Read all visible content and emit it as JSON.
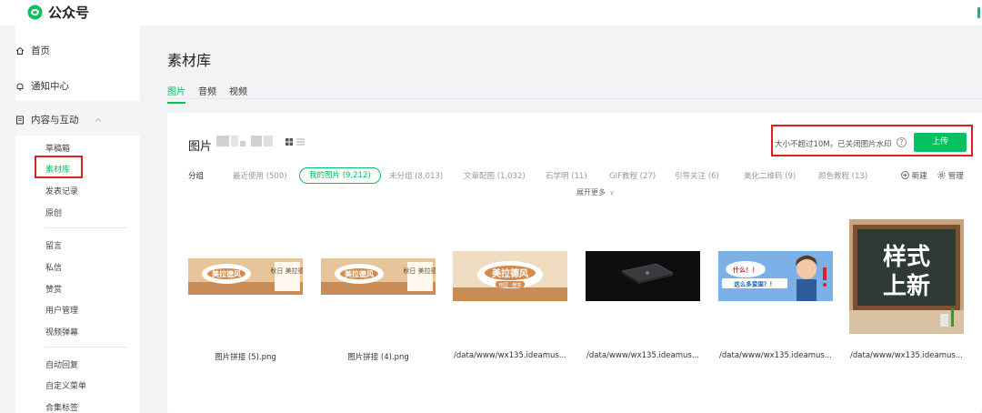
{
  "app": {
    "title": "公众号"
  },
  "sidebar": {
    "home": "首页",
    "notify": "通知中心",
    "content_section": "内容与互动",
    "items_a": [
      "草稿箱",
      "素材库",
      "发表记录",
      "原创"
    ],
    "items_b": [
      "留言",
      "私信",
      "赞赏",
      "用户管理",
      "视频弹幕"
    ],
    "items_c": [
      "自动回复",
      "自定义菜单",
      "合集标签"
    ]
  },
  "main": {
    "title": "素材库",
    "tabs": [
      {
        "label": "图片"
      },
      {
        "label": "音频"
      },
      {
        "label": "视频"
      }
    ]
  },
  "library": {
    "heading": "图片",
    "upload_hint": "大小不超过10M，已关闭图片水印",
    "help_icon": "?",
    "upload_label": "上传",
    "groups_label": "分组",
    "groups": [
      "最近使用 (500)",
      "我的图片 (9,212)",
      "未分组 (8,013)",
      "文章配图 (1,032)",
      "石学明 (11)",
      "GIF教程 (27)",
      "引导关注 (6)",
      "美化二维码 (9)",
      "颜色教程 (13)"
    ],
    "new_label": "新建",
    "manage_label": "管理",
    "expand_label": "展开更多",
    "expand_arrow": "∨",
    "images": [
      {
        "name": "图片拼接 (5).png",
        "caption_a": "美拉德风",
        "caption_b": "秋日 美拉德"
      },
      {
        "name": "图片拼接 (4).png",
        "caption_a": "美拉德风",
        "caption_b": "秋日 美拉德"
      },
      {
        "name": "/data/www/wx135.ideamus...",
        "caption_a": "美拉德风",
        "caption_b": "田园 · 暖意"
      },
      {
        "name": "/data/www/wx135.ideamus...",
        "caption_a": "",
        "caption_b": ""
      },
      {
        "name": "/data/www/wx135.ideamus...",
        "caption_a": "什么！！",
        "caption_b": "这么多爱国？！"
      },
      {
        "name": "/data/www/wx135.ideamus...",
        "caption_a": "样式",
        "caption_b": "上新"
      }
    ]
  },
  "colors": {
    "accent": "#07c160",
    "highlight": "#e02020"
  }
}
